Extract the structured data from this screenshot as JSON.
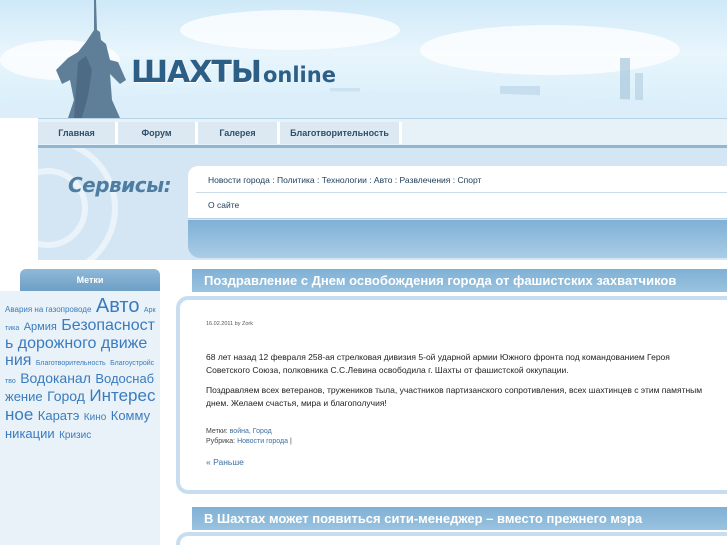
{
  "header": {
    "logo_main": "ШАХТЫ",
    "logo_sub": "online"
  },
  "nav": {
    "items": [
      "Главная",
      "Форум",
      "Галерея",
      "Благотворительность"
    ]
  },
  "services": {
    "title": "Сервисы:",
    "links": [
      "Новости города",
      "Политика",
      "Технологии",
      "Авто",
      "Развлечения",
      "Спорт"
    ],
    "separator": " : ",
    "about": "О сайте"
  },
  "sidebar": {
    "title": "Метки",
    "tags": [
      {
        "label": "Авария на газопроводе",
        "size": 8
      },
      {
        "label": "Авто",
        "size": 20
      },
      {
        "label": "Арктика",
        "size": 7
      },
      {
        "label": "Армия",
        "size": 11
      },
      {
        "label": "Безопасность дорожного движения",
        "size": 16
      },
      {
        "label": "Благотворительность",
        "size": 7
      },
      {
        "label": "Благоустройство",
        "size": 7
      },
      {
        "label": "Водоканал",
        "size": 14
      },
      {
        "label": "Водоснабжение",
        "size": 13
      },
      {
        "label": "Город",
        "size": 14
      },
      {
        "label": "Интересное",
        "size": 17
      },
      {
        "label": "Каратэ",
        "size": 13
      },
      {
        "label": "Кино",
        "size": 10
      },
      {
        "label": "Коммуникации",
        "size": 13
      },
      {
        "label": "Кризис",
        "size": 10
      }
    ]
  },
  "posts": [
    {
      "title": "Поздравление с Днем освобождения города от фашистских захватчиков",
      "meta": "16.02.2011 by Zork",
      "paragraphs": [
        "68 лет назад 12 февраля 258-ая стрелковая дивизия 5-ой ударной армии Южного фронта под командованием Героя Советского Союза, полковника С.С.Левина освободила г. Шахты от фашистской оккупации.",
        "Поздравляем всех ветеранов, тружеников тыла, участников партизанского сопротивления, всех шахтинцев с этим памятным днем. Желаем счастья, мира и благополучия!"
      ],
      "tags_label": "Метки:",
      "tags": "война, Город",
      "rubric_label": "Рубрика:",
      "rubric": "Новости города",
      "rubric_suffix": "|",
      "more": "« Раньше"
    },
    {
      "title": "В Шахтах может появиться сити-менеджер – вместо прежнего мэра"
    }
  ]
}
